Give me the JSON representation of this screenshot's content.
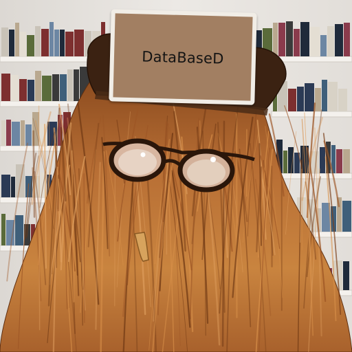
{
  "scene": {
    "sign_text": "DataBaseD",
    "colors": {
      "wall": "#e9e6e2",
      "shelf": "#f3f0ec",
      "hair_light": "#c07a3a",
      "hair_dark": "#7a3f18",
      "hat": "#3a2010",
      "sign_fill": "#a27f62",
      "sign_border": "#f1ede6"
    },
    "icons": [
      "hairy-figure",
      "round-glasses",
      "bowler-hat",
      "cigar",
      "bookshelves"
    ]
  }
}
